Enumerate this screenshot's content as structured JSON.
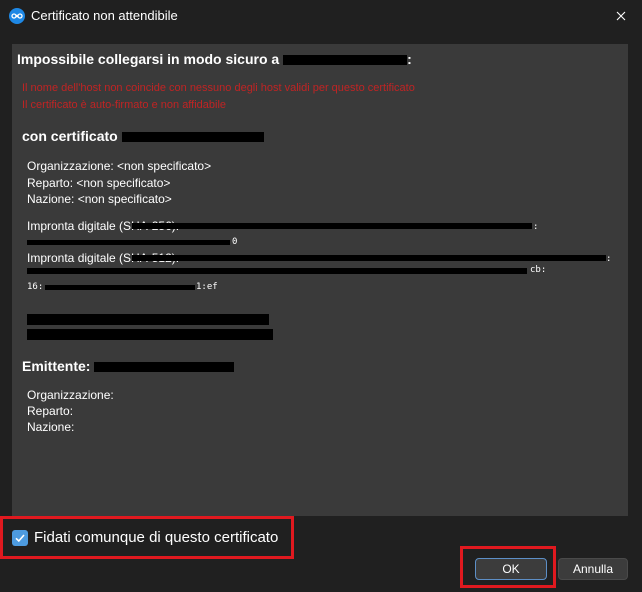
{
  "window": {
    "title": "Certificato non attendibile",
    "close_icon": "close-icon",
    "app_icon": "nextcloud-icon"
  },
  "dialog": {
    "heading": "Impossibile collegarsi in modo sicuro a",
    "heading_suffix": ":",
    "errors": [
      "Il nome dell'host non coincide con nessuno degli host validi per questo certificato",
      "Il certificato è auto-firmato e non affidabile"
    ],
    "cert_heading": "con certificato",
    "subject": {
      "organization": "Organizzazione: <non specificato>",
      "department": "Reparto: <non specificato>",
      "nation": "Nazione: <non specificato>"
    },
    "fingerprint_sha256_label": "Impronta digitale (SHA-256):",
    "fingerprint_sha256_end": "0",
    "fingerprint_sha512_label": "Impronta digitale (SHA-512):",
    "fingerprint_sha512_line2_end": "cb:",
    "fingerprint_sha512_line3_start": "16:",
    "fingerprint_sha512_line3_end": "1:ef",
    "issuer_heading": "Emittente:",
    "issuer": {
      "organization": "Organizzazione:",
      "department": "Reparto:",
      "nation": "Nazione:"
    }
  },
  "footer": {
    "trust_checkbox_label": "Fidati comunque di questo certificato",
    "trust_checked": true,
    "ok_label": "OK",
    "cancel_label": "Annulla"
  },
  "colors": {
    "error": "#c02424",
    "accent": "#4d9be0",
    "highlight": "#e0191f"
  }
}
